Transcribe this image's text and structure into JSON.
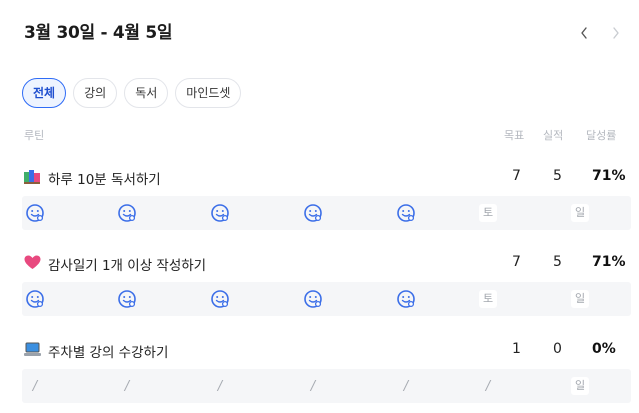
{
  "header": {
    "title": "3월 30일 - 4월 5일"
  },
  "chips": [
    "전체",
    "강의",
    "독서",
    "마인드셋"
  ],
  "columns": {
    "routine": "루틴",
    "goal": "목표",
    "actual": "실적",
    "rate": "달성률"
  },
  "colors": {
    "accent": "#2f6cf6",
    "smiley": "#3b6ee8",
    "heart": "#e8497f"
  },
  "routines": [
    {
      "icon": "books-icon",
      "name": "하루 10분 독서하기",
      "goal": "7",
      "actual": "5",
      "rate": "71%",
      "days": [
        "done",
        "done",
        "done",
        "done",
        "done",
        "토",
        "일"
      ]
    },
    {
      "icon": "heart-icon",
      "name": "감사일기 1개 이상 작성하기",
      "goal": "7",
      "actual": "5",
      "rate": "71%",
      "days": [
        "done",
        "done",
        "done",
        "done",
        "done",
        "토",
        "일"
      ]
    },
    {
      "icon": "laptop-icon",
      "name": "주차별 강의 수강하기",
      "goal": "1",
      "actual": "0",
      "rate": "0%",
      "days": [
        "/",
        "/",
        "/",
        "/",
        "/",
        "/",
        "일"
      ]
    }
  ]
}
